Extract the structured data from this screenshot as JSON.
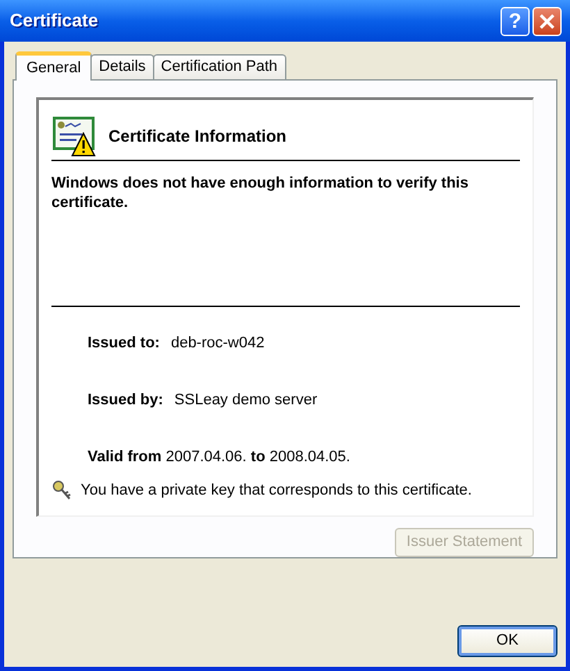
{
  "window": {
    "title": "Certificate",
    "help_glyph": "?"
  },
  "tabs": [
    {
      "label": "General",
      "selected": true
    },
    {
      "label": "Details",
      "selected": false
    },
    {
      "label": "Certification Path",
      "selected": false
    }
  ],
  "info": {
    "heading": "Certificate Information",
    "warning": "Windows does not have enough information to verify this certificate.",
    "fields": [
      {
        "label": "Issued to:",
        "value": "deb-roc-w042"
      },
      {
        "label": "Issued by:",
        "value": "SSLeay demo server"
      }
    ],
    "validity": "**Valid from** 2007.04.06. **to** 2008.04.05.",
    "key_note": "You have a private key that corresponds to this certificate."
  },
  "issuer_button": {
    "label": "Issuer Statement",
    "disabled": true
  },
  "buttons": [
    "OK"
  ]
}
